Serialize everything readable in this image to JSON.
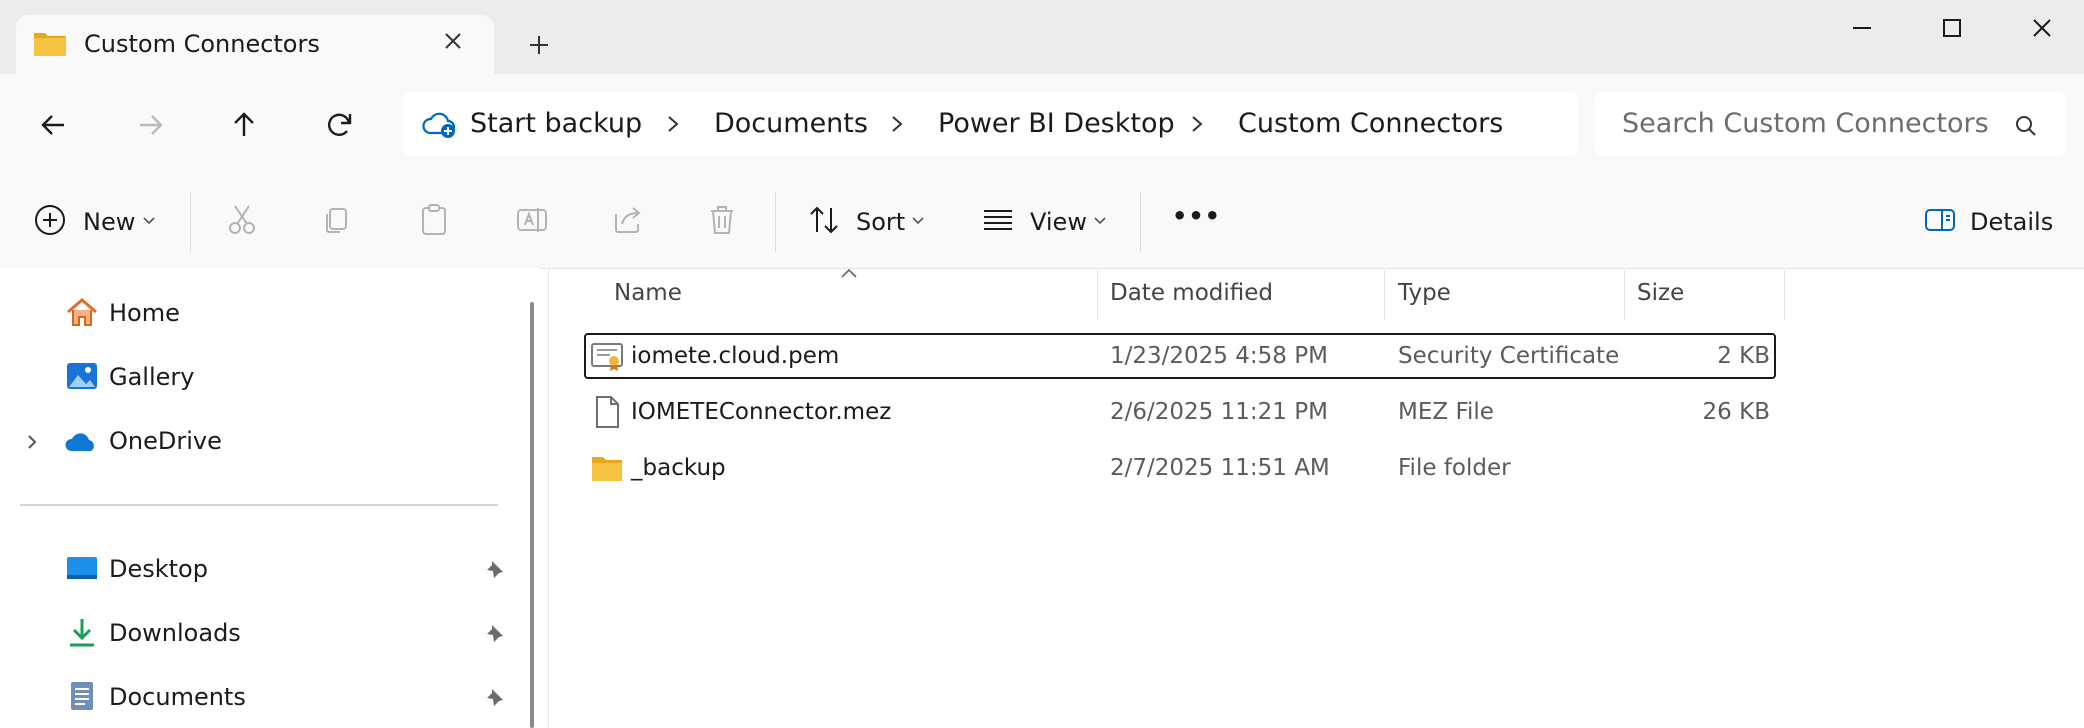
{
  "window": {
    "tab_title": "Custom Connectors",
    "new_tab": "+",
    "controls": {
      "minimize": "minimize-icon",
      "maximize": "maximize-icon",
      "close": "close-icon"
    }
  },
  "address": {
    "sync_label": "Start backup",
    "breadcrumbs": [
      "Documents",
      "Power BI Desktop",
      "Custom Connectors"
    ],
    "search_placeholder": "Search Custom Connectors"
  },
  "toolbar": {
    "new_label": "New",
    "sort_label": "Sort",
    "view_label": "View",
    "more_label": "•••",
    "details_label": "Details"
  },
  "sidebar": {
    "items": [
      {
        "label": "Home",
        "icon": "home-icon"
      },
      {
        "label": "Gallery",
        "icon": "gallery-icon"
      },
      {
        "label": "OneDrive",
        "icon": "onedrive-icon"
      },
      {
        "label": "Desktop",
        "icon": "desktop-icon",
        "pinned": true
      },
      {
        "label": "Downloads",
        "icon": "downloads-icon",
        "pinned": true
      },
      {
        "label": "Documents",
        "icon": "documents-icon",
        "pinned": true
      }
    ]
  },
  "files": {
    "columns": {
      "name": "Name",
      "date": "Date modified",
      "type": "Type",
      "size": "Size"
    },
    "rows": [
      {
        "name": "iomete.cloud.pem",
        "date": "1/23/2025 4:58 PM",
        "type": "Security Certificate",
        "size": "2 KB",
        "icon": "certificate-icon"
      },
      {
        "name": "IOMETEConnector.mez",
        "date": "2/6/2025 11:21 PM",
        "type": "MEZ File",
        "size": "26 KB",
        "icon": "file-icon"
      },
      {
        "name": "_backup",
        "date": "2/7/2025 11:51 AM",
        "type": "File folder",
        "size": "",
        "icon": "folder-icon"
      }
    ]
  },
  "colors": {
    "accent": "#0067c0",
    "folder": "#f6c343",
    "titlebar": "#ececec"
  }
}
